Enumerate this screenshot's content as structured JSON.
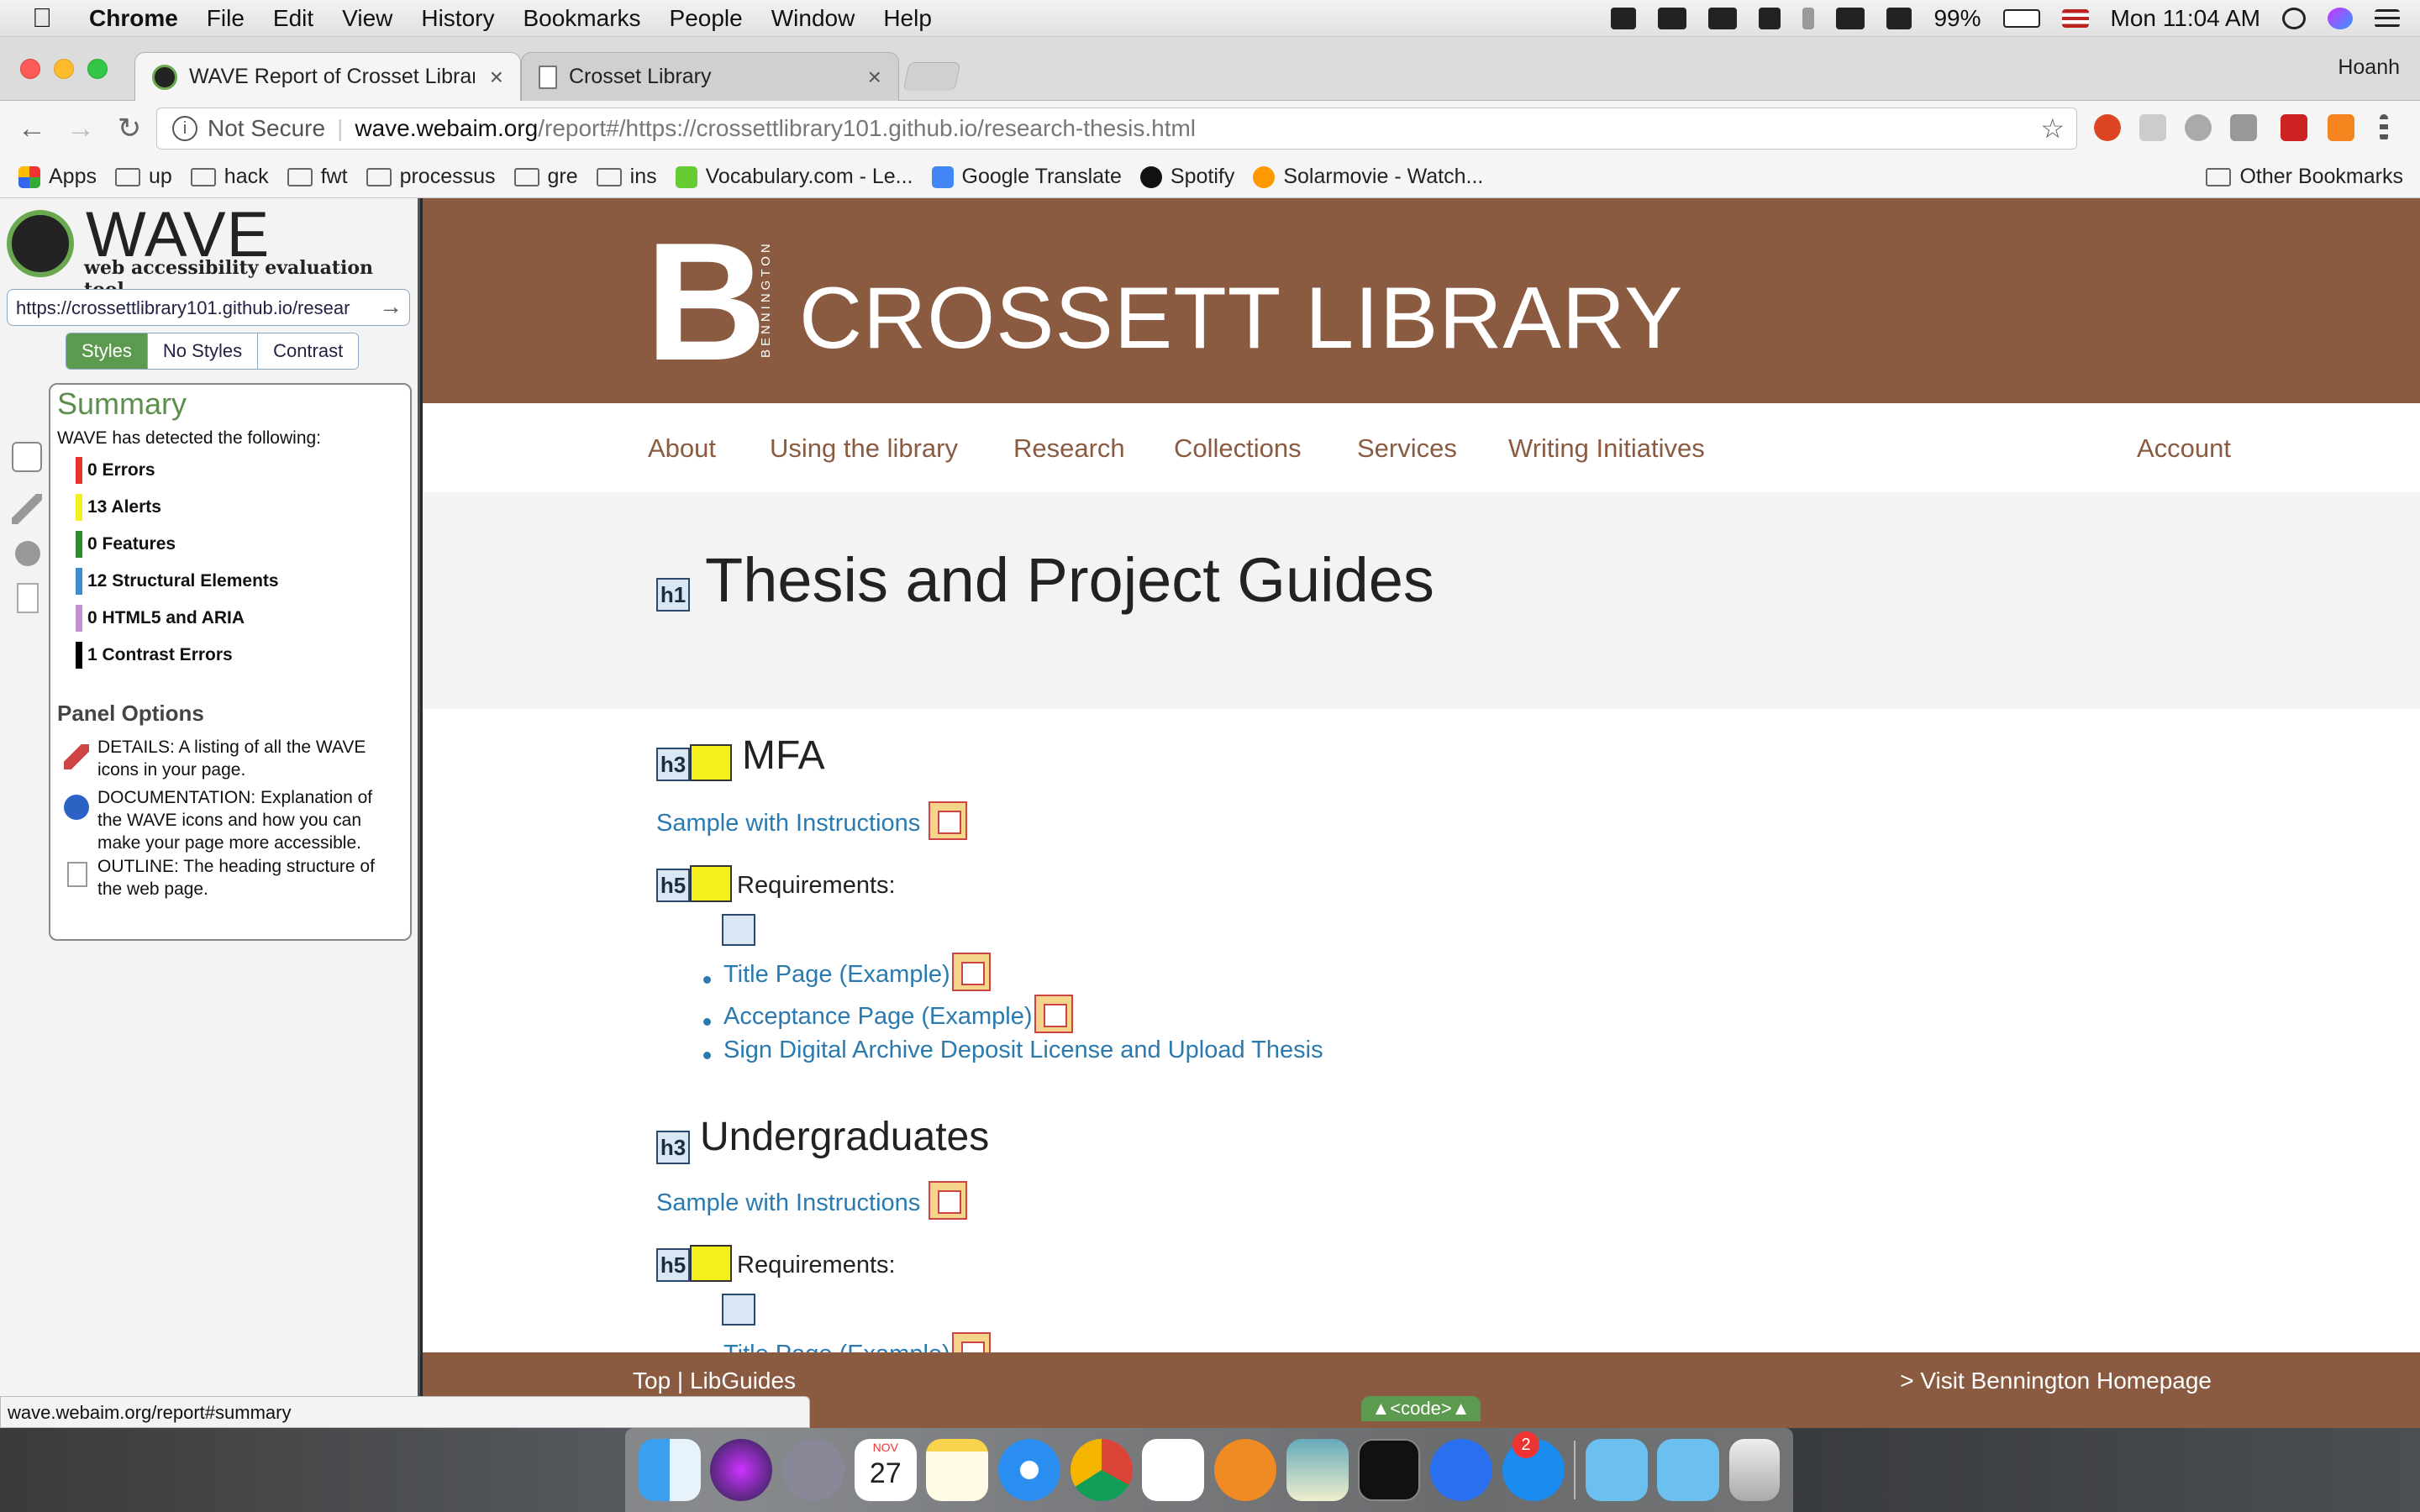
{
  "menubar": {
    "app": "Chrome",
    "items": [
      "File",
      "Edit",
      "View",
      "History",
      "Bookmarks",
      "People",
      "Window",
      "Help"
    ],
    "battery": "99%",
    "clock": "Mon 11:04 AM"
  },
  "tabs": [
    {
      "title": "WAVE Report of Crosset Library",
      "close": "×"
    },
    {
      "title": "Crosset Library",
      "close": "×"
    }
  ],
  "profile": "Hoanh",
  "omnibox": {
    "security": "Not Secure",
    "host": "wave.webaim.org",
    "path": "/report#/https://crossettlibrary101.github.io/research-thesis.html"
  },
  "bookmarks": {
    "items": [
      "Apps",
      "up",
      "hack",
      "fwt",
      "processus",
      "gre",
      "ins",
      "Vocabulary.com - Le...",
      "Google Translate",
      "Spotify",
      "Solarmovie - Watch..."
    ],
    "other": "Other Bookmarks"
  },
  "wave": {
    "title": "WAVE",
    "subtitle": "web accessibility evaluation tool",
    "url": "https://crossettlibrary101.github.io/resear",
    "modes": [
      "Styles",
      "No Styles",
      "Contrast"
    ],
    "summary": {
      "title": "Summary",
      "desc": "WAVE has detected the following:",
      "rows": [
        {
          "label": "0 Errors",
          "color": "#e8302c"
        },
        {
          "label": "13 Alerts",
          "color": "#f5ef1b"
        },
        {
          "label": "0 Features",
          "color": "#2e8b2e"
        },
        {
          "label": "12 Structural Elements",
          "color": "#3b8ed6"
        },
        {
          "label": "0 HTML5 and ARIA",
          "color": "#c58fd6"
        },
        {
          "label": "1 Contrast Errors",
          "color": "#000000"
        }
      ]
    },
    "panel_options": {
      "title": "Panel Options",
      "details": "DETAILS: A listing of all the WAVE icons in your page.",
      "documentation": "DOCUMENTATION: Explanation of the WAVE icons and how you can make your page more accessible.",
      "outline": "OUTLINE: The heading structure of the web page."
    }
  },
  "library": {
    "logo_letter": "B",
    "logo_vertical": "BENNINGTON",
    "name": "CROSSETT LIBRARY",
    "nav": [
      "About",
      "Using the library",
      "Research",
      "Collections",
      "Services",
      "Writing Initiatives"
    ],
    "account": "Account",
    "page_title": "Thesis and Project Guides",
    "sections": [
      {
        "heading": "MFA",
        "sample_link": "Sample with Instructions",
        "req_label": "Requirements:",
        "items": [
          "Title Page (Example)",
          "Acceptance Page (Example)",
          "Sign Digital Archive Deposit License and Upload Thesis"
        ]
      },
      {
        "heading": "Undergraduates",
        "sample_link": "Sample with Instructions",
        "req_label": "Requirements:",
        "items": [
          "Title Page (Example)"
        ]
      }
    ],
    "badges": {
      "h1": "h1",
      "h3": "h3",
      "h5": "h5"
    },
    "footer_left": "Top | LibGuides",
    "footer_right": "> Visit Bennington Homepage"
  },
  "code_toggle": "▲<code>▲",
  "status_url": "wave.webaim.org/report#summary",
  "dock": {
    "calendar_day": "27",
    "calendar_month": "NOV",
    "notification_count": "2"
  }
}
